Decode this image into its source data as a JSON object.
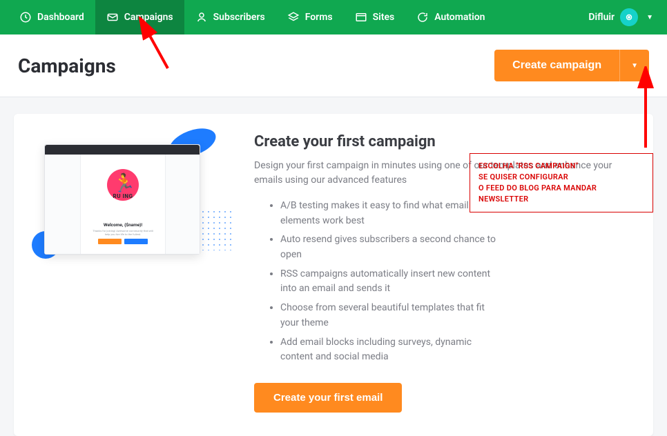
{
  "nav": {
    "items": [
      {
        "label": "Dashboard"
      },
      {
        "label": "Campaigns"
      },
      {
        "label": "Subscribers"
      },
      {
        "label": "Forms"
      },
      {
        "label": "Sites"
      },
      {
        "label": "Automation"
      }
    ],
    "brand_name": "Difluir"
  },
  "page": {
    "title": "Campaigns",
    "create_btn": "Create campaign"
  },
  "card": {
    "title": "Create your first campaign",
    "desc": "Design your first campaign in minutes using one of our templates and enhance your emails using our advanced features",
    "features": [
      "A/B testing makes it easy to find what email elements work best",
      "Auto resend gives subscribers a second chance to open",
      "RSS campaigns automatically insert new content into an email and sends it",
      "Choose from several beautiful templates that fit your theme",
      "Add email blocks including surveys, dynamic content and social media"
    ],
    "cta": "Create your first email",
    "mock_running": "RU   ING",
    "mock_welcome": "Welcome, {$name}!"
  },
  "annotation": {
    "line1": "ESCOLHA \"RSS CAMPAIGN\"",
    "line2": "SE QUISER CONFIGURAR",
    "line3": "O FEED DO BLOG PARA MANDAR",
    "line4": "NEWSLETTER"
  }
}
